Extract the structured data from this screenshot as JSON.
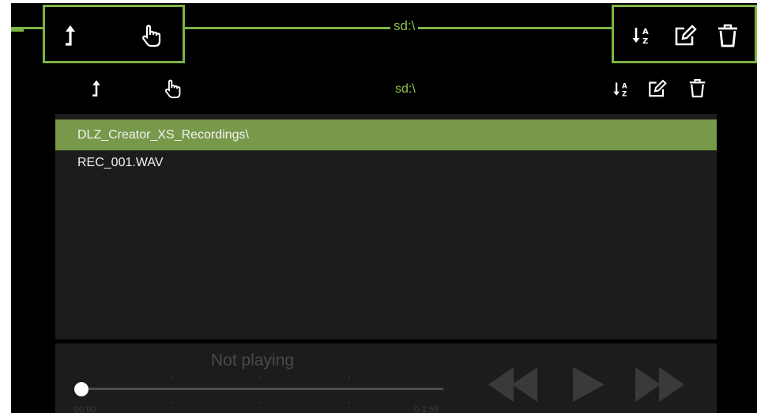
{
  "callout": {
    "path": "sd:\\",
    "color": "#7cb342",
    "left_icons": [
      "up-folder-icon",
      "hand-pointer-icon"
    ],
    "right_icons": [
      "sort-az-icon",
      "edit-icon",
      "trash-icon"
    ]
  },
  "toolbar": {
    "path": "sd:\\",
    "left_icons": [
      "up-folder-icon",
      "hand-pointer-icon"
    ],
    "right_icons": [
      "sort-az-icon",
      "edit-icon",
      "trash-icon"
    ]
  },
  "files": [
    {
      "name": "DLZ_Creator_XS_Recordings\\",
      "selected": true
    },
    {
      "name": "REC_001.WAV",
      "selected": false
    }
  ],
  "player": {
    "status": "Not playing",
    "time_start": "00:00",
    "time_end": "0-1:59",
    "progress": 0,
    "controls": [
      "rewind-icon",
      "play-icon",
      "fast-forward-icon"
    ]
  },
  "colors": {
    "accent": "#8bc34a",
    "selection": "#78994a",
    "panel": "#1c1c1c",
    "background": "#000000"
  }
}
